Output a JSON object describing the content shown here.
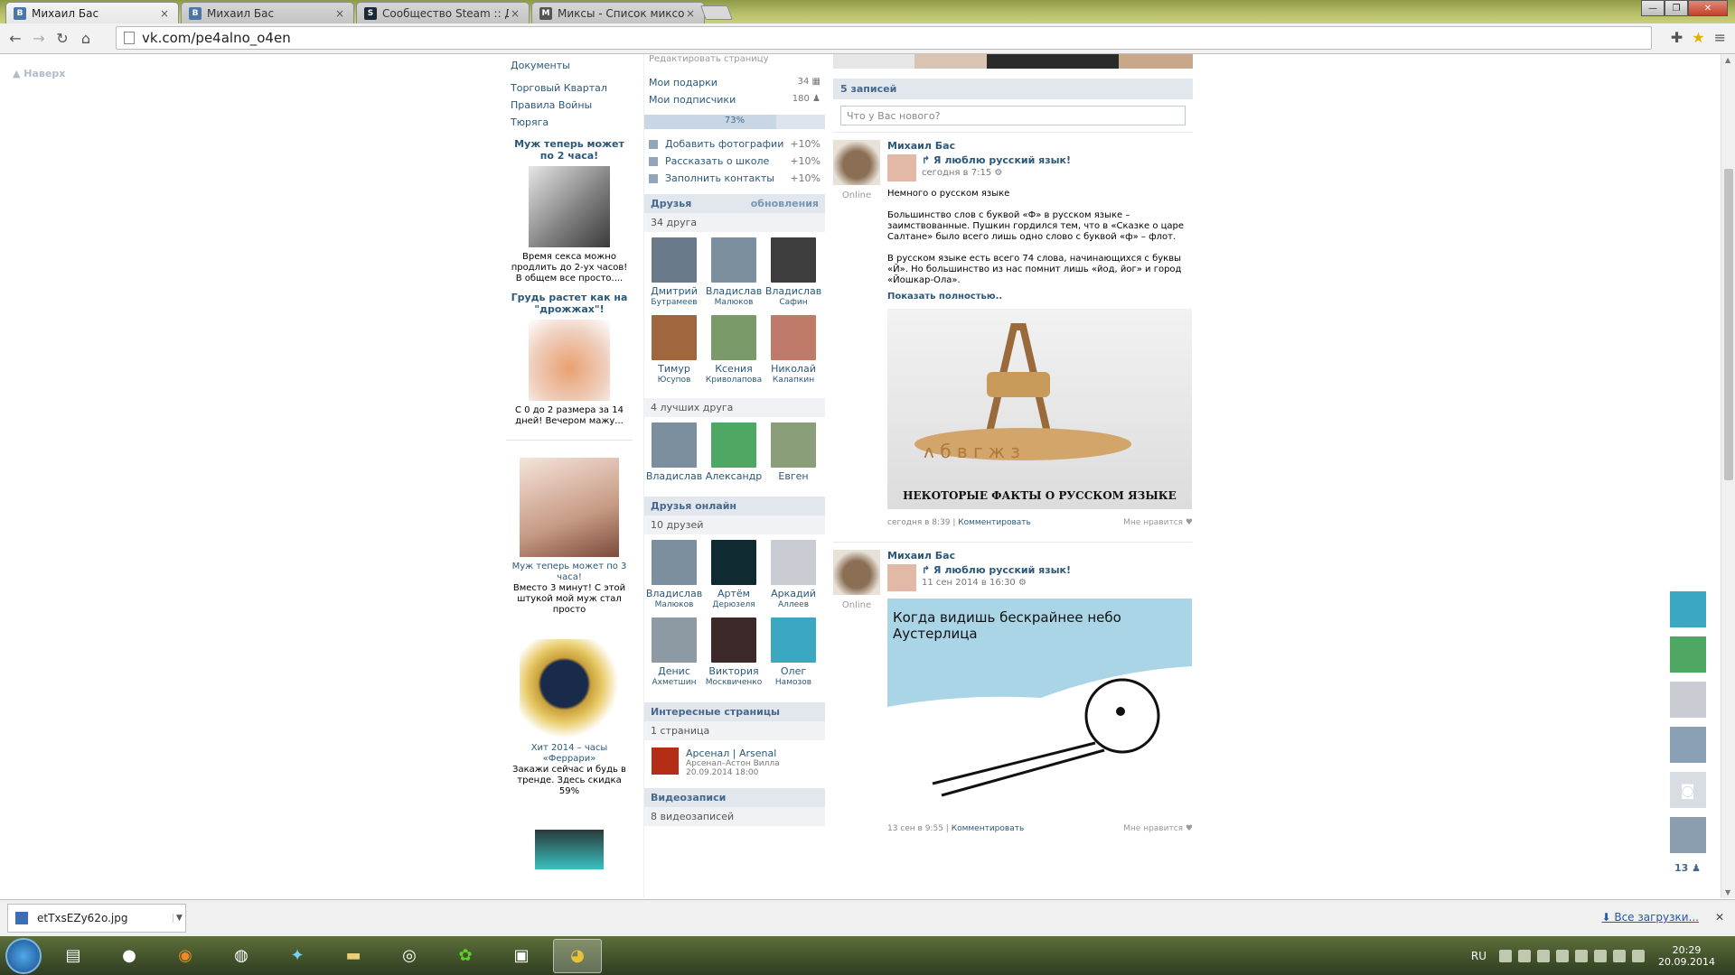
{
  "browser": {
    "tabs": [
      {
        "label": "Михаил Бас",
        "fav_color": "#4a76a8",
        "fav_letter": "В",
        "active": true
      },
      {
        "label": "Михаил Бас",
        "fav_color": "#4a76a8",
        "fav_letter": "В",
        "active": false
      },
      {
        "label": "Сообщество Steam :: Др",
        "fav_color": "#1b2838",
        "fav_letter": "S",
        "active": false
      },
      {
        "label": "Миксы - Список миксов",
        "fav_color": "#555",
        "fav_letter": "М",
        "active": false
      }
    ],
    "url": "vk.com/pe4alno_o4en",
    "tab_close": "×"
  },
  "page": {
    "naverh": "Наверх"
  },
  "left": {
    "links": [
      "Документы",
      "Торговый Квартал",
      "Правила Войны",
      "Тюряга"
    ],
    "ads": [
      {
        "title": "Муж теперь может по 2 часа!",
        "desc": "Время секса можно продлить до 2-ух часов! В общем все просто....",
        "color": "#c9c9c9"
      },
      {
        "title": "Грудь растет как на \"дрожжах\"!",
        "desc": "С 0 до 2 размера за 14 дней! Вечером мажу...",
        "color": "#dcb8a8"
      },
      {
        "title": "",
        "link": "Муж теперь может по 3 часа!",
        "desc": "Вместо 3 минут! С этой штукой мой муж стал просто",
        "color": "#d8b9a8"
      },
      {
        "title": "",
        "link": "Хит 2014 – часы «Феррари»",
        "desc": "Закажи сейчас и будь в тренде. Здесь скидка 59%",
        "color": "#b58a2f"
      }
    ]
  },
  "profile": {
    "edit_link": "Редактировать страницу",
    "gifts": {
      "label": "Мои подарки",
      "count": "34"
    },
    "subs": {
      "label": "Мои подписчики",
      "count": "180"
    },
    "progress": {
      "value": 0.73,
      "label": "73%"
    },
    "tips": [
      {
        "label": "Добавить фотографии",
        "plus": "+10%"
      },
      {
        "label": "Рассказать о школе",
        "plus": "+10%"
      },
      {
        "label": "Заполнить контакты",
        "plus": "+10%"
      }
    ],
    "friends": {
      "title": "Друзья",
      "updates": "обновления",
      "count": "34 друга",
      "items": [
        {
          "first": "Дмитрий",
          "last": "Бутрамеев",
          "color": "#6a7a8a"
        },
        {
          "first": "Владислав",
          "last": "Малюков",
          "color": "#7b8f9e"
        },
        {
          "first": "Владислав",
          "last": "Сафин",
          "color": "#3e3e3e"
        },
        {
          "first": "Тимур",
          "last": "Юсупов",
          "color": "#a0673f"
        },
        {
          "first": "Ксения",
          "last": "Криволапова",
          "color": "#7a9a6a"
        },
        {
          "first": "Николай",
          "last": "Калапкин",
          "color": "#c07a6a"
        }
      ],
      "best_label": "4 лучших друга",
      "best": [
        {
          "first": "Владислав",
          "color": "#7b8f9e"
        },
        {
          "first": "Александр",
          "color": "#4ea864"
        },
        {
          "first": "Евген",
          "color": "#8a9e7a"
        }
      ]
    },
    "online": {
      "title": "Друзья онлайн",
      "count": "10 друзей",
      "items": [
        {
          "first": "Владислав",
          "last": "Малюков",
          "color": "#7b8f9e"
        },
        {
          "first": "Артём",
          "last": "Дерюзеля",
          "color": "#0f2a30"
        },
        {
          "first": "Аркадий",
          "last": "Аллеев",
          "color": "#c9ccd2"
        },
        {
          "first": "Денис",
          "last": "Ахметшин",
          "color": "#8e9aa3"
        },
        {
          "first": "Виктория",
          "last": "Москвиченко",
          "color": "#3c2a2a"
        },
        {
          "first": "Олег",
          "last": "Намозов",
          "color": "#3aa8c0"
        }
      ]
    },
    "pages": {
      "title": "Интересные страницы",
      "count": "1 страница",
      "item": {
        "name": "Арсенал | Arsenal",
        "sub": "Арсенал–Астон Вилла",
        "date": "20.09.2014 18:00"
      }
    },
    "video": {
      "title": "Видеозаписи",
      "count": "8 видеозаписей"
    }
  },
  "wall": {
    "count": "5 записей",
    "placeholder": "Что у Вас нового?",
    "posts": [
      {
        "author": "Михаил Бас",
        "online": "Online",
        "group": "Я люблю русский язык!",
        "date": "сегодня в 7:15",
        "text1": "Немного о русском языке",
        "text2": "Большинство слов с буквой «Ф» в русском языке – заимствованные. Пушкин гордился тем, что в «Сказке о царе Салтане» было всего лишь одно слово с буквой «ф» – флот.",
        "text3": "В русском языке есть всего 74 слова, начинающихся с буквы «Й». Но большинство из нас помнит лишь «йод, йог» и город «Йошкар-Ола».",
        "more": "Показать полностью..",
        "img_caption": "НЕКОТОРЫЕ ФАКТЫ О РУССКОМ ЯЗЫКЕ",
        "foot_date": "сегодня в 8:39",
        "comment": "Комментировать",
        "like": "Мне нравится"
      },
      {
        "author": "Михаил Бас",
        "online": "Online",
        "group": "Я люблю русский язык!",
        "date": "11 сен 2014 в 16:30",
        "img_caption": "Когда видишь бескрайнее небо Аустерлица",
        "foot_date": "13 сен в 9:55",
        "comment": "Комментировать",
        "like": "Мне нравится"
      }
    ]
  },
  "rail": {
    "avatars": [
      "#3aa8c0",
      "#4ea864",
      "#c9ccd2",
      "#8aa0b4",
      "#d8dde3",
      "#8a9eaf"
    ],
    "count": "13"
  },
  "downloads": {
    "file": "etTxsEZy62o.jpg",
    "all": "Все загрузки..."
  },
  "taskbar": {
    "lang": "RU",
    "time": "20:29",
    "date": "20.09.2014"
  }
}
